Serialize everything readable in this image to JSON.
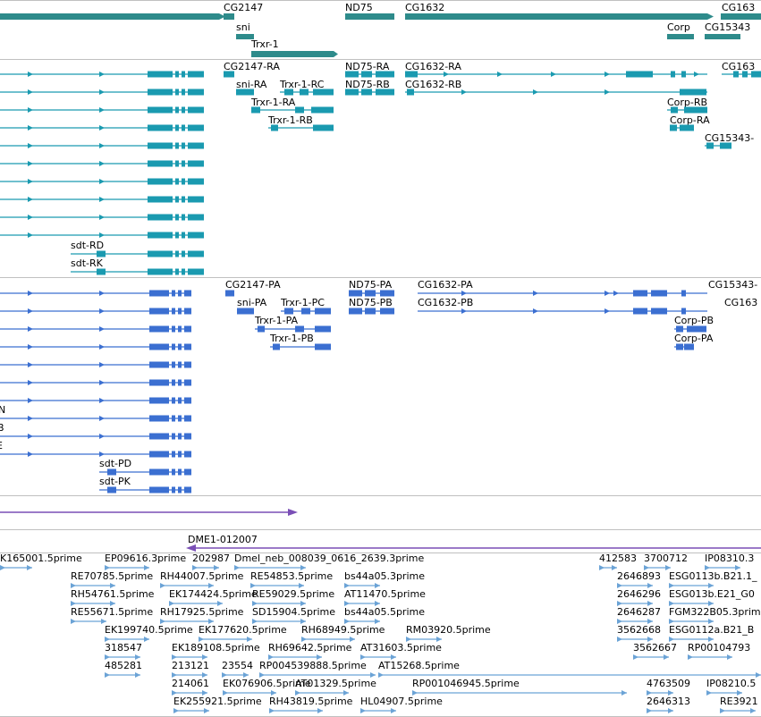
{
  "view": "genome-browser-tracks",
  "colors": {
    "gene": "#2e8b8b",
    "transcript": "#1a9ab0",
    "protein": "#3b6fd1",
    "misc_feature": "#7a4fb6",
    "est": "#6ba3d6",
    "divider": "#c0c0c0"
  },
  "gene_labels": {
    "cg2147": "CG2147",
    "nd75": "ND75",
    "cg1632": "CG1632",
    "cg1636_cut": "CG163",
    "sni": "sni",
    "trxr1": "Trxr-1",
    "corp": "Corp",
    "cg15343": "CG15343"
  },
  "transcript_labels": {
    "cg2147_ra": "CG2147-RA",
    "nd75_ra": "ND75-RA",
    "cg1632_ra": "CG1632-RA",
    "cg1636_cut": "CG163",
    "sni_ra": "sni-RA",
    "trxr1_rc": "Trxr-1-RC",
    "nd75_rb": "ND75-RB",
    "cg1632_rb": "CG1632-RB",
    "trxr1_ra": "Trxr-1-RA",
    "corp_rb": "Corp-RB",
    "trxr1_rb": "Trxr-1-RB",
    "corp_ra": "Corp-RA",
    "cg15343_cut": "CG15343-",
    "sdt_rd": "sdt-RD",
    "sdt_rk": "sdt-RK"
  },
  "protein_labels": {
    "cg2147_pa": "CG2147-PA",
    "nd75_pa": "ND75-PA",
    "cg1632_pa": "CG1632-PA",
    "cg15343_cut": "CG15343-",
    "sni_pa": "sni-PA",
    "trxr1_pc": "Trxr-1-PC",
    "nd75_pb": "ND75-PB",
    "cg1632_pb": "CG1632-PB",
    "cg163_cut": "CG163",
    "trxr1_pa": "Trxr-1-PA",
    "corp_pb": "Corp-PB",
    "trxr1_pb": "Trxr-1-PB",
    "corp_pa": "Corp-PA",
    "cut_n": "N",
    "cut_b": "B",
    "cut_e": "E",
    "sdt_pd": "sdt-PD",
    "sdt_pk": "sdt-PK"
  },
  "misc_label": "DME1-012007",
  "est_labels": [
    "K165001.5prime",
    "EP09616.3prime",
    "202987",
    "Dmel_neb_008039_0616_2639.3prime",
    "412583",
    "3700712",
    "IP08310.3",
    "RE70785.5prime",
    "RH44007.5prime",
    "RE54853.5prime",
    "bs44a05.3prime",
    "2646893",
    "ESG0113b.B21.1_",
    "RH54761.5prime",
    "EK174424.5prime",
    "RE59029.5prime",
    "AT11470.5prime",
    "2646296",
    "ESG013b.E21_G0",
    "RE55671.5prime",
    "RH17925.5prime",
    "SD15904.5prime",
    "bs44a05.5prime",
    "2646287",
    "FGM322B05.3prime",
    "EK199740.5prime",
    "EK177620.5prime",
    "RH68949.5prime",
    "RM03920.5prime",
    "3562668",
    "ESG0112a.B21_B",
    "318547",
    "EK189108.5prime",
    "RH69642.5prime",
    "AT31603.5prime",
    "3562667",
    "RP00104793",
    "485281",
    "213121",
    "23554",
    "RP004539888.5prime",
    "AT15268.5prime",
    "214061",
    "EK076906.5prime",
    "AT01329.5prime",
    "RP001046945.5prime",
    "4763509",
    "IP08210.5",
    "EK255921.5prime",
    "RH43819.5prime",
    "HL04907.5prime",
    "2646313",
    "RE3921"
  ]
}
